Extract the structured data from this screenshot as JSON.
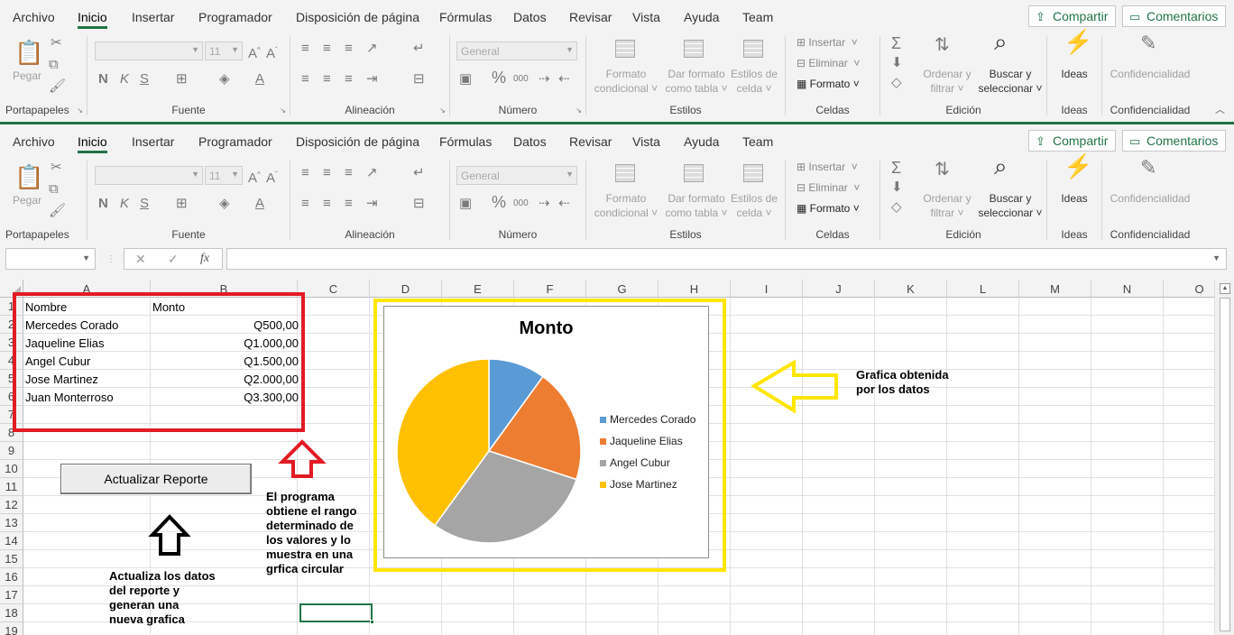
{
  "ribbon": {
    "tabs": [
      "Archivo",
      "Inicio",
      "Insertar",
      "Programador",
      "Disposición de página",
      "Fórmulas",
      "Datos",
      "Revisar",
      "Vista",
      "Ayuda",
      "Team"
    ],
    "active_tab": "Inicio",
    "share_label": "Compartir",
    "comments_label": "Comentarios",
    "groups": {
      "portapapeles": "Portapapeles",
      "fuente": "Fuente",
      "alineacion": "Alineación",
      "numero": "Número",
      "estilos": "Estilos",
      "celdas": "Celdas",
      "edicion": "Edición",
      "ideas": "Ideas",
      "confidencialidad": "Confidencialidad"
    },
    "paste_label": "Pegar",
    "font_size": "11",
    "bold": "N",
    "italic": "K",
    "underline": "S",
    "number_format": "General",
    "styles": {
      "formato_condicional": [
        "Formato",
        "condicional"
      ],
      "dar_formato": [
        "Dar formato",
        "como tabla"
      ],
      "estilos_celda": [
        "Estilos de",
        "celda"
      ]
    },
    "cells": {
      "insertar": "Insertar",
      "eliminar": "Eliminar",
      "formato": "Formato"
    },
    "edit": {
      "ordenar": [
        "Ordenar y",
        "filtrar"
      ],
      "buscar": [
        "Buscar y",
        "seleccionar"
      ]
    },
    "ideas_label": "Ideas",
    "confidencialidad_label": "Confidencialidad"
  },
  "formula_bar": {
    "name_box": "",
    "fx": "fx",
    "formula": ""
  },
  "columns": [
    "A",
    "B",
    "C",
    "D",
    "E",
    "F",
    "G",
    "H",
    "I",
    "J",
    "K",
    "L",
    "M",
    "N",
    "O"
  ],
  "rows": [
    "1",
    "2",
    "3",
    "4",
    "5",
    "6",
    "7",
    "8",
    "9",
    "10",
    "11",
    "12",
    "13",
    "14",
    "15",
    "16",
    "17",
    "18",
    "19"
  ],
  "sheet": {
    "headers": [
      "Nombre",
      "Monto"
    ],
    "records": [
      {
        "nombre": "Mercedes Corado",
        "monto": "Q500,00"
      },
      {
        "nombre": "Jaqueline Elias",
        "monto": "Q1.000,00"
      },
      {
        "nombre": "Angel Cubur",
        "monto": "Q1.500,00"
      },
      {
        "nombre": "Jose Martinez",
        "monto": "Q2.000,00"
      },
      {
        "nombre": "Juan Monterroso",
        "monto": "Q3.300,00"
      }
    ]
  },
  "update_button": "Actualizar Reporte",
  "annotations": {
    "chart_note": [
      "Grafica obtenida",
      "por los datos"
    ],
    "range_note": [
      "El programa",
      "obtiene el rango",
      "determinado de",
      "los valores y lo",
      "muestra en una",
      "grfica circular"
    ],
    "button_note": [
      "Actualiza los datos",
      "del reporte y",
      "generan una",
      "nueva grafica"
    ]
  },
  "colors": {
    "accent": "#217346",
    "red_frame": "#e21b24",
    "yellow_frame": "#ffe600",
    "series": [
      "#5b9bd5",
      "#ed7d31",
      "#a5a5a5",
      "#ffc000"
    ]
  },
  "chart_data": {
    "type": "pie",
    "title": "Monto",
    "categories": [
      "Mercedes Corado",
      "Jaqueline Elias",
      "Angel Cubur",
      "Jose Martinez"
    ],
    "values": [
      500,
      1000,
      1500,
      2000
    ],
    "legend": "right"
  }
}
